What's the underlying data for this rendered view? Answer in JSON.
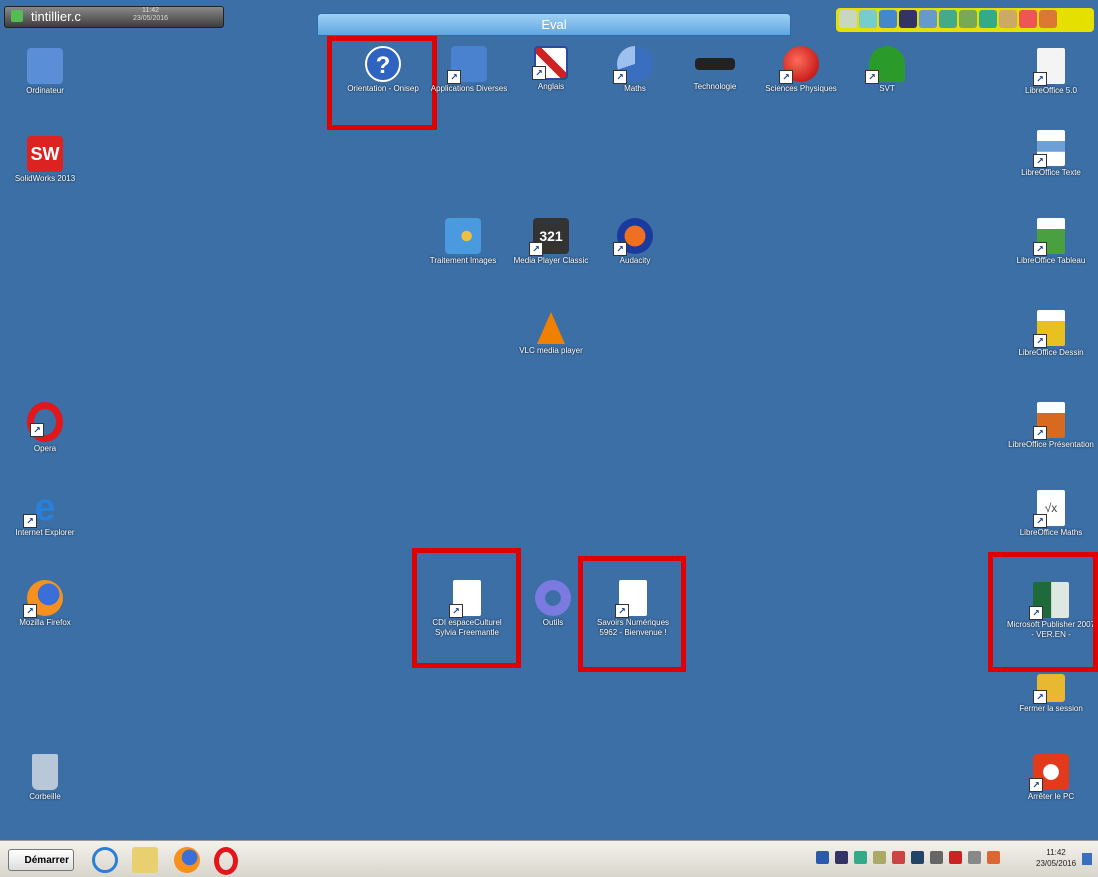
{
  "topbar": {
    "user_name": "tintillier.c",
    "user_time": "11:42",
    "user_date": "23/05/2016",
    "center_title": "Eval"
  },
  "desktop_icons": {
    "ordinateur": "Ordinateur",
    "solidworks": "SolidWorks 2013",
    "opera": "Opera",
    "ie": "Internet Explorer",
    "firefox": "Mozilla Firefox",
    "corbeille": "Corbeille",
    "orientation": "Orientation - Onisep",
    "applications": "Applications Diverses",
    "anglais": "Anglais",
    "maths": "Maths",
    "technologie": "Technologie",
    "sciences": "Sciences Physiques",
    "svt": "SVT",
    "traitement": "Traitement Images",
    "mpc": "Media Player Classic",
    "audacity": "Audacity",
    "vlc": "VLC media player",
    "cdi": "CDI espaceCulturel Sylvia Freemantle",
    "outils": "Outils",
    "savoirs": "Savoirs Numériques 5962 - Bienvenue !",
    "lo50": "LibreOffice 5.0",
    "lotexte": "LibreOffice Texte",
    "lotableau": "LibreOffice Tableau",
    "lodessin": "LibreOffice Dessin",
    "lopres": "LibreOffice Présentation",
    "lomaths": "LibreOffice Maths",
    "publisher": "Microsoft Publisher 2007 - VER.EN -",
    "fermer": "Fermer la session",
    "arreter": "Arrêter le PC"
  },
  "taskbar": {
    "start_label": "Démarrer",
    "clock_time": "11:42",
    "clock_date": "23/05/2016"
  },
  "colors": {
    "desktop": "#3b6fa6",
    "highlight": "#e00000",
    "toolbar_yellow": "#e6e000"
  }
}
